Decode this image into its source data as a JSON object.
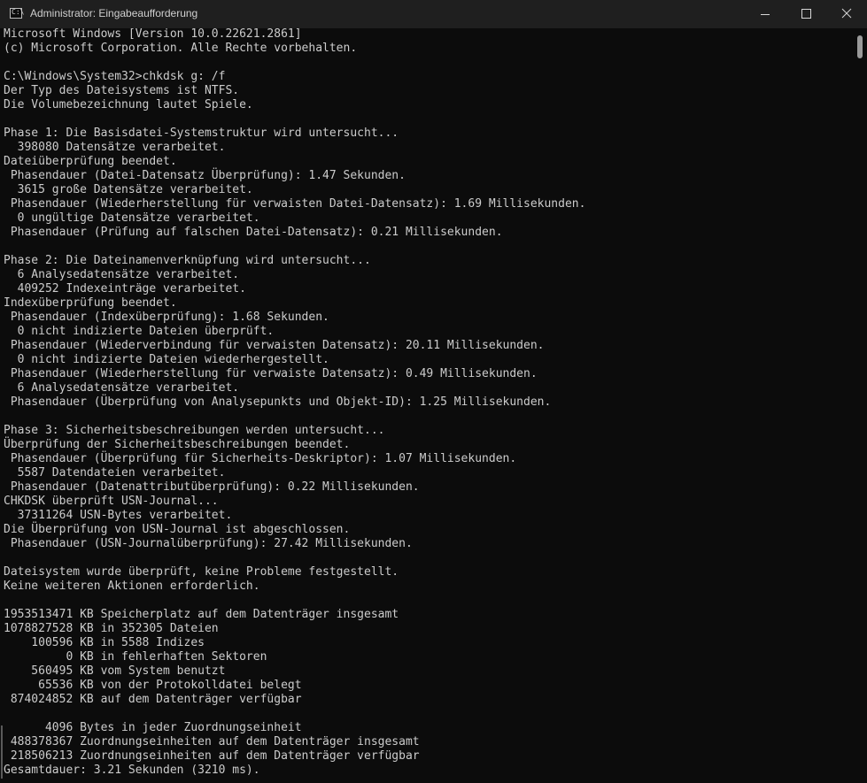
{
  "window": {
    "title": "Administrator: Eingabeaufforderung",
    "icon": "cmd-icon"
  },
  "controls": {
    "minimize": "minimize-icon",
    "maximize": "maximize-icon",
    "close": "close-icon"
  },
  "colors": {
    "background": "#0c0c0c",
    "text": "#cccccc",
    "titlebar": "#1f1f1f"
  },
  "console": {
    "lines": [
      "Microsoft Windows [Version 10.0.22621.2861]",
      "(c) Microsoft Corporation. Alle Rechte vorbehalten.",
      "",
      "C:\\Windows\\System32>chkdsk g: /f",
      "Der Typ des Dateisystems ist NTFS.",
      "Die Volumebezeichnung lautet Spiele.",
      "",
      "Phase 1: Die Basisdatei-Systemstruktur wird untersucht...",
      "  398080 Datensätze verarbeitet.",
      "Dateiüberprüfung beendet.",
      " Phasendauer (Datei-Datensatz Überprüfung): 1.47 Sekunden.",
      "  3615 große Datensätze verarbeitet.",
      " Phasendauer (Wiederherstellung für verwaisten Datei-Datensatz): 1.69 Millisekunden.",
      "  0 ungültige Datensätze verarbeitet.",
      " Phasendauer (Prüfung auf falschen Datei-Datensatz): 0.21 Millisekunden.",
      "",
      "Phase 2: Die Dateinamenverknüpfung wird untersucht...",
      "  6 Analysedatensätze verarbeitet.",
      "  409252 Indexeinträge verarbeitet.",
      "Indexüberprüfung beendet.",
      " Phasendauer (Indexüberprüfung): 1.68 Sekunden.",
      "  0 nicht indizierte Dateien überprüft.",
      " Phasendauer (Wiederverbindung für verwaisten Datensatz): 20.11 Millisekunden.",
      "  0 nicht indizierte Dateien wiederhergestellt.",
      " Phasendauer (Wiederherstellung für verwaiste Datensatz): 0.49 Millisekunden.",
      "  6 Analysedatensätze verarbeitet.",
      " Phasendauer (Überprüfung von Analysepunkts und Objekt-ID): 1.25 Millisekunden.",
      "",
      "Phase 3: Sicherheitsbeschreibungen werden untersucht...",
      "Überprüfung der Sicherheitsbeschreibungen beendet.",
      " Phasendauer (Überprüfung für Sicherheits-Deskriptor): 1.07 Millisekunden.",
      "  5587 Datendateien verarbeitet.",
      " Phasendauer (Datenattributüberprüfung): 0.22 Millisekunden.",
      "CHKDSK überprüft USN-Journal...",
      "  37311264 USN-Bytes verarbeitet.",
      "Die Überprüfung von USN-Journal ist abgeschlossen.",
      " Phasendauer (USN-Journalüberprüfung): 27.42 Millisekunden.",
      "",
      "Dateisystem wurde überprüft, keine Probleme festgestellt.",
      "Keine weiteren Aktionen erforderlich.",
      "",
      "1953513471 KB Speicherplatz auf dem Datenträger insgesamt",
      "1078827528 KB in 352305 Dateien",
      "    100596 KB in 5588 Indizes",
      "         0 KB in fehlerhaften Sektoren",
      "    560495 KB vom System benutzt",
      "     65536 KB von der Protokolldatei belegt",
      " 874024852 KB auf dem Datenträger verfügbar",
      "",
      "      4096 Bytes in jeder Zuordnungseinheit",
      " 488378367 Zuordnungseinheiten auf dem Datenträger insgesamt",
      " 218506213 Zuordnungseinheiten auf dem Datenträger verfügbar",
      "Gesamtdauer: 3.21 Sekunden (3210 ms)."
    ]
  }
}
